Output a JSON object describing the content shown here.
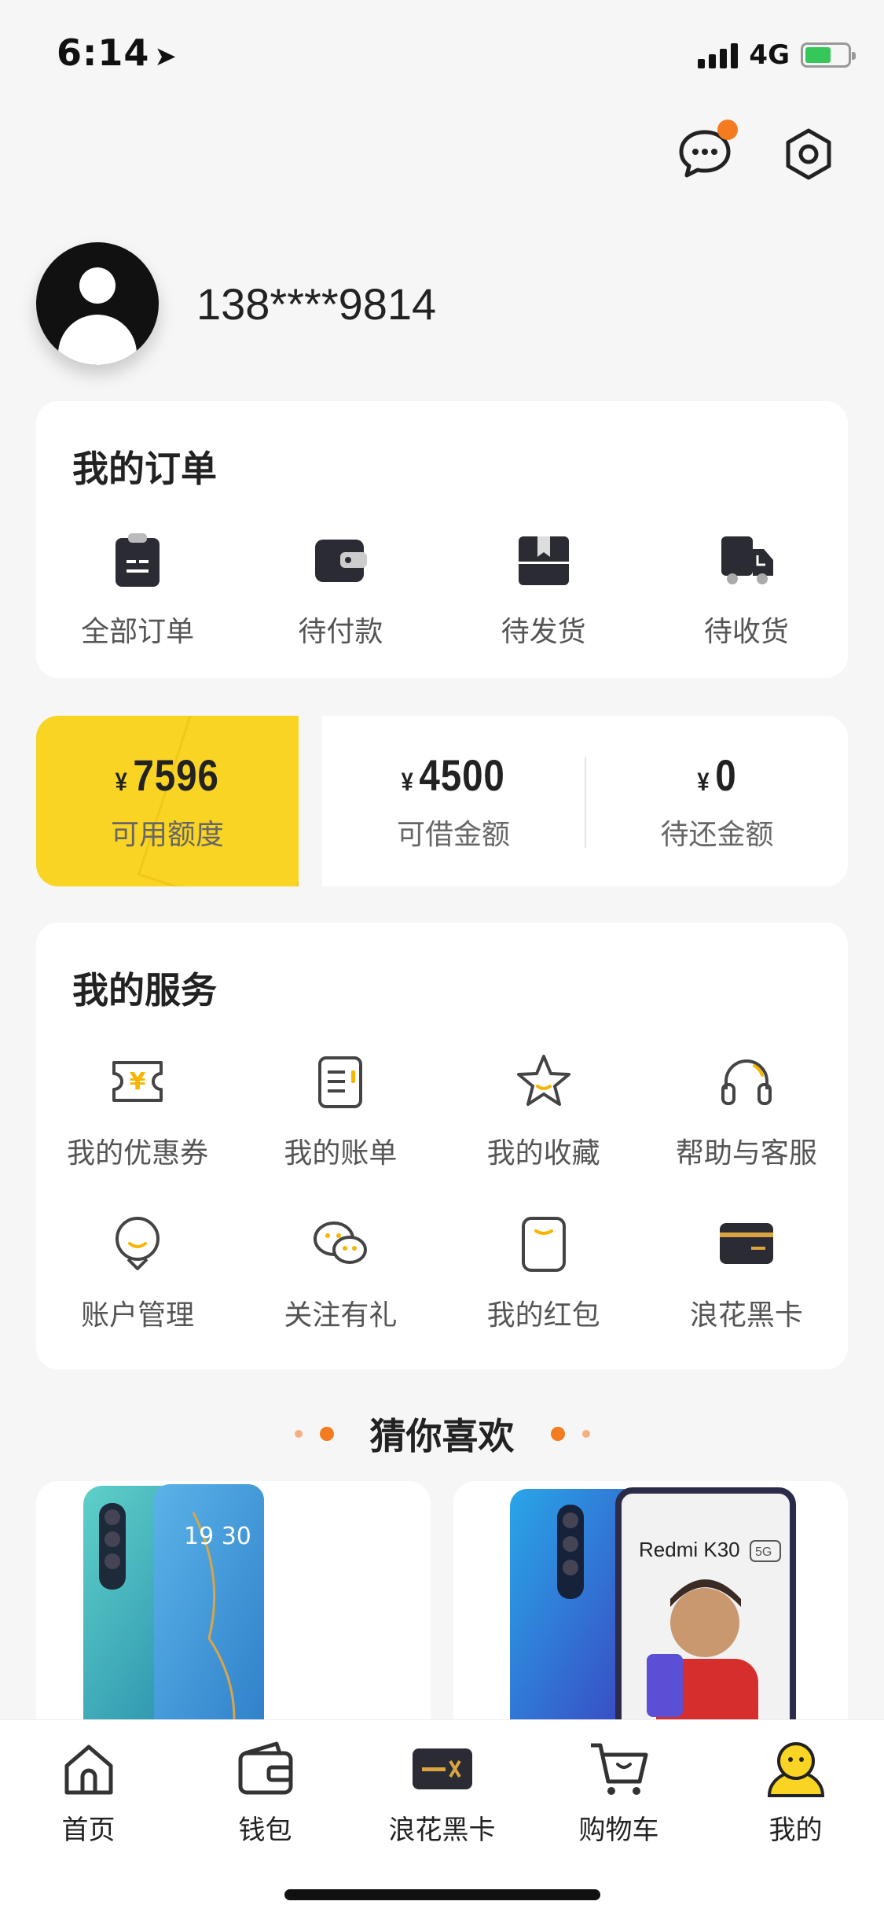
{
  "status": {
    "time": "6:14",
    "network": "4G"
  },
  "profile": {
    "phone": "138****9814"
  },
  "orders": {
    "title": "我的订单",
    "items": [
      {
        "label": "全部订单",
        "icon": "clipboard-icon"
      },
      {
        "label": "待付款",
        "icon": "wallet-icon"
      },
      {
        "label": "待发货",
        "icon": "package-icon"
      },
      {
        "label": "待收货",
        "icon": "truck-icon"
      }
    ]
  },
  "credit": {
    "currency": "¥",
    "available": {
      "value": "7596",
      "label": "可用额度"
    },
    "borrowable": {
      "value": "4500",
      "label": "可借金额"
    },
    "repay": {
      "value": "0",
      "label": "待还金额"
    }
  },
  "services": {
    "title": "我的服务",
    "items": [
      {
        "label": "我的优惠券",
        "icon": "coupon-icon"
      },
      {
        "label": "我的账单",
        "icon": "bill-icon"
      },
      {
        "label": "我的收藏",
        "icon": "star-icon"
      },
      {
        "label": "帮助与客服",
        "icon": "headset-icon"
      },
      {
        "label": "账户管理",
        "icon": "account-icon"
      },
      {
        "label": "关注有礼",
        "icon": "wechat-icon"
      },
      {
        "label": "我的红包",
        "icon": "red-packet-icon"
      },
      {
        "label": "浪花黑卡",
        "icon": "black-card-icon"
      }
    ]
  },
  "recommend": {
    "title": "猜你喜欢",
    "products": [
      {
        "image_text": "19 30"
      },
      {
        "image_text": "Redmi K30",
        "badge": "5G"
      }
    ]
  },
  "tabbar": {
    "items": [
      {
        "label": "首页",
        "icon": "home-icon"
      },
      {
        "label": "钱包",
        "icon": "wallet-icon"
      },
      {
        "label": "浪花黑卡",
        "icon": "black-card-icon"
      },
      {
        "label": "购物车",
        "icon": "cart-icon"
      },
      {
        "label": "我的",
        "icon": "profile-icon",
        "active": true
      }
    ]
  },
  "colors": {
    "accent": "#f9d423",
    "orange": "#f47b20",
    "icon_dark": "#2b2b33"
  }
}
